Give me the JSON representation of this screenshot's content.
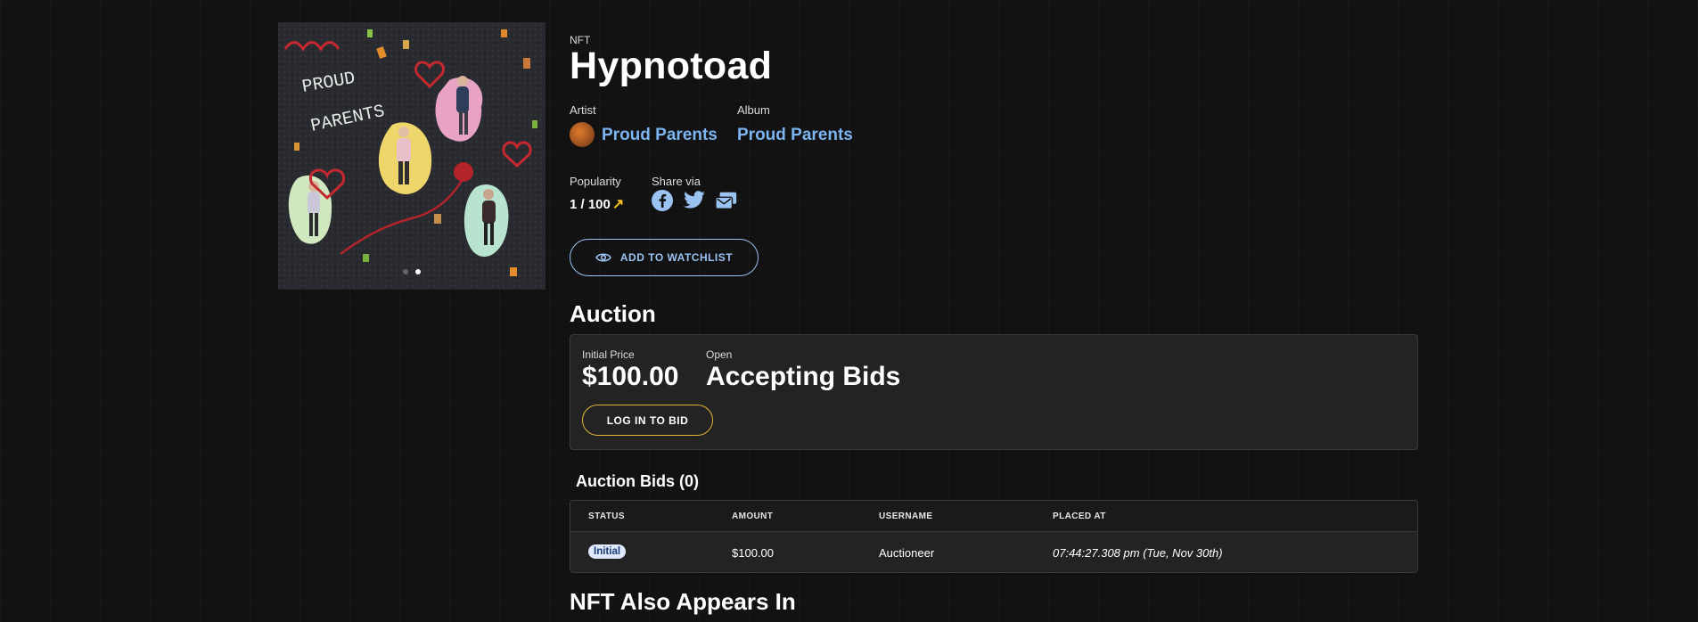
{
  "nft": {
    "eyebrow": "NFT",
    "title": "Hypnotoad",
    "artwork_alt": "Proud Parents album art"
  },
  "artist": {
    "label": "Artist",
    "name": "Proud Parents"
  },
  "album": {
    "label": "Album",
    "name": "Proud Parents"
  },
  "popularity": {
    "label": "Popularity",
    "value": "1 / 100",
    "icon": "trending-up-icon"
  },
  "share": {
    "label": "Share via",
    "icons": [
      "facebook-icon",
      "twitter-icon",
      "share-message-icon"
    ]
  },
  "watchlist": {
    "label": "ADD TO WATCHLIST",
    "icon": "eye-icon"
  },
  "auction": {
    "heading": "Auction",
    "initial_price_label": "Initial Price",
    "initial_price": "$100.00",
    "status_label": "Open",
    "status": "Accepting Bids",
    "bid_button": "LOG IN TO BID"
  },
  "bids": {
    "heading": "Auction Bids (0)",
    "columns": [
      "STATUS",
      "AMOUNT",
      "USERNAME",
      "PLACED AT"
    ],
    "rows": [
      {
        "status": "Initial",
        "amount": "$100.00",
        "username": "Auctioneer",
        "placed_at": "07:44:27.308 pm (Tue, Nov 30th)"
      }
    ]
  },
  "appears_heading": "NFT Also Appears In",
  "artwork_text": [
    "PROUD",
    "PARENTS"
  ],
  "colors": {
    "link": "#7bb4f0",
    "accent_gold": "#e2b437",
    "watch_border": "#9ac3f2",
    "trend": "#f5c021"
  },
  "carousel": {
    "slides": 2,
    "active": 2
  }
}
